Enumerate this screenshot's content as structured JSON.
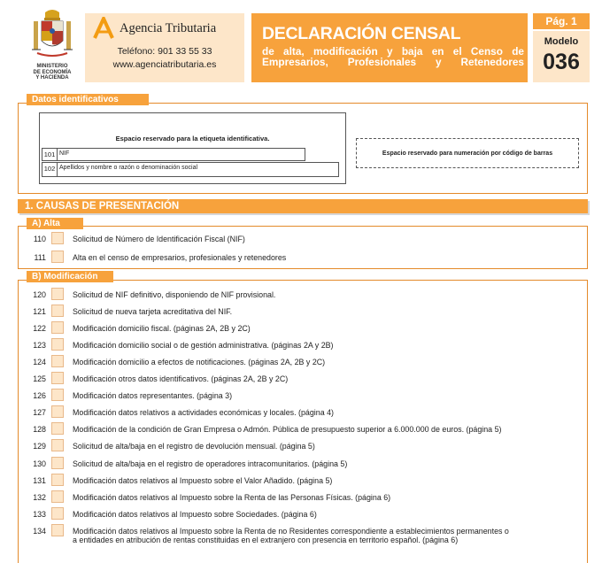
{
  "header": {
    "ministry": [
      "MINISTERIO",
      "DE ECONOMÍA",
      "Y HACIENDA"
    ],
    "agency_name": "Agencia Tributaria",
    "phone": "Teléfono: 901 33 55 33",
    "website": "www.agenciatributaria.es",
    "title": "DECLARACIÓN CENSAL",
    "subtitle": "de alta, modificación y baja en el Censo de Empresarios, Profesionales y Retenedores",
    "page": "Pág. 1",
    "modelo_label": "Modelo",
    "modelo_number": "036"
  },
  "datos": {
    "tab": "Datos identificativos",
    "label_reserved": "Espacio reservado para la etiqueta identificativa.",
    "nif_num": "101",
    "nif_label": "NIF",
    "name_num": "102",
    "name_label": "Apellidos y nombre o razón o denominación social",
    "barcode_reserved": "Espacio reservado para numeración por código de barras"
  },
  "section1": {
    "title": "1. CAUSAS DE PRESENTACIÓN",
    "alta": {
      "tab": "A) Alta",
      "items": [
        {
          "num": "110",
          "text": "Solicitud de Número de Identificación Fiscal (NIF)"
        },
        {
          "num": "111",
          "text": "Alta en el censo de empresarios, profesionales y retenedores"
        }
      ]
    },
    "modificacion": {
      "tab": "B) Modificación",
      "items": [
        {
          "num": "120",
          "text": "Solicitud de NIF definitivo, disponiendo de NIF provisional."
        },
        {
          "num": "121",
          "text": "Solicitud de nueva tarjeta acreditativa del NIF."
        },
        {
          "num": "122",
          "text": "Modificación domicilio fiscal. (páginas 2A, 2B y 2C)"
        },
        {
          "num": "123",
          "text": "Modificación domicilio social o de gestión administrativa. (páginas 2A y 2B)"
        },
        {
          "num": "124",
          "text": "Modificación domicilio a efectos de notificaciones. (páginas 2A, 2B y 2C)"
        },
        {
          "num": "125",
          "text": "Modificación otros datos identificativos. (páginas 2A, 2B y 2C)"
        },
        {
          "num": "126",
          "text": "Modificación datos representantes. (página 3)"
        },
        {
          "num": "127",
          "text": "Modificación datos relativos a actividades económicas y locales. (página 4)"
        },
        {
          "num": "128",
          "text": "Modificación de la condición de Gran Empresa o Admón. Pública de presupuesto superior a 6.000.000 de euros. (página 5)"
        },
        {
          "num": "129",
          "text": "Solicitud de alta/baja en el registro de devolución mensual. (página 5)"
        },
        {
          "num": "130",
          "text": "Solicitud de alta/baja en el registro de operadores intracomunitarios. (página 5)"
        },
        {
          "num": "131",
          "text": "Modificación datos relativos al Impuesto sobre el Valor Añadido. (página 5)"
        },
        {
          "num": "132",
          "text": "Modificación datos relativos al Impuesto sobre la Renta de las Personas Físicas. (página 6)"
        },
        {
          "num": "133",
          "text": "Modificación datos relativos al Impuesto sobre Sociedades. (página 6)"
        },
        {
          "num": "134",
          "text": "Modificación datos relativos al Impuesto sobre la Renta de no Residentes correspondiente a establecimientos permanentes o a entidades en atribución de rentas constituidas en el extranjero con presencia en territorio español. (página 6)"
        }
      ]
    }
  },
  "colors": {
    "orange": "#f7a23c",
    "peach": "#fde6c9",
    "border": "#e48a2a"
  }
}
